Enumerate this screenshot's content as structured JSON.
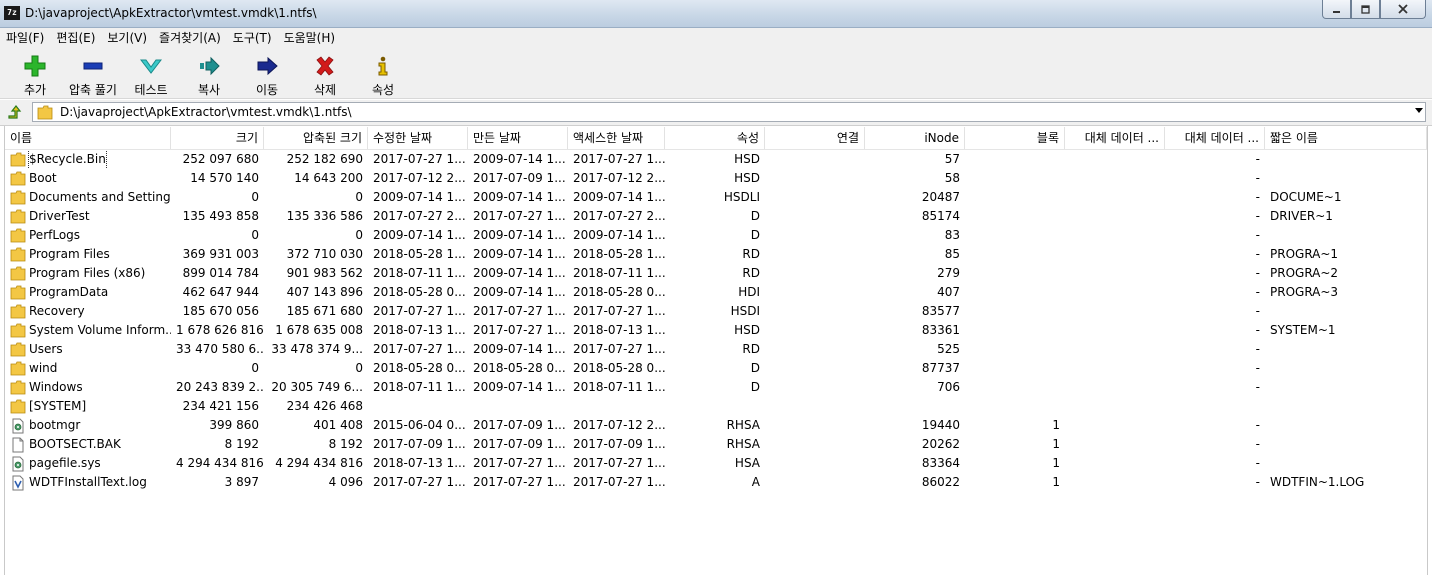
{
  "window": {
    "app_icon_text": "7z",
    "title": "D:\\javaproject\\ApkExtractor\\vmtest.vmdk\\1.ntfs\\",
    "controls": [
      "minimize",
      "maximize",
      "close"
    ]
  },
  "menu": [
    "파일(F)",
    "편집(E)",
    "보기(V)",
    "즐겨찾기(A)",
    "도구(T)",
    "도움말(H)"
  ],
  "toolbar": [
    {
      "label": "추가",
      "icon": "add-icon",
      "color": "#2bb52b"
    },
    {
      "label": "압축 풀기",
      "icon": "extract-icon",
      "color": "#1a3db5"
    },
    {
      "label": "테스트",
      "icon": "test-icon",
      "color": "#2fb5b5"
    },
    {
      "label": "복사",
      "icon": "copy-icon",
      "color": "#1e8f8f"
    },
    {
      "label": "이동",
      "icon": "move-icon",
      "color": "#1a2a8f"
    },
    {
      "label": "삭제",
      "icon": "delete-icon",
      "color": "#d21b1b"
    },
    {
      "label": "속성",
      "icon": "info-icon",
      "color": "#c9a400"
    }
  ],
  "address": {
    "path": "D:\\javaproject\\ApkExtractor\\vmtest.vmdk\\1.ntfs\\"
  },
  "columns": [
    "이름",
    "크기",
    "압축된 크기",
    "수정한 날짜",
    "만든 날짜",
    "액세스한 날짜",
    "속성",
    "연결",
    "iNode",
    "블록",
    "대체 데이터 ...",
    "대체 데이터 ...",
    "짧은 이름"
  ],
  "files": [
    {
      "name": "$Recycle.Bin",
      "type": "folder",
      "size": "252 097 680",
      "packed": "252 182 690",
      "modified": "2017-07-27 1...",
      "created": "2009-07-14 1...",
      "accessed": "2017-07-27 1...",
      "attr": "HSD",
      "link": "",
      "inode": "57",
      "blocks": "",
      "alt1": "",
      "alt2": "-",
      "short": ""
    },
    {
      "name": "Boot",
      "type": "folder",
      "size": "14 570 140",
      "packed": "14 643 200",
      "modified": "2017-07-12 2...",
      "created": "2017-07-09 1...",
      "accessed": "2017-07-12 2...",
      "attr": "HSD",
      "link": "",
      "inode": "58",
      "blocks": "",
      "alt1": "",
      "alt2": "-",
      "short": ""
    },
    {
      "name": "Documents and Settings",
      "type": "folder",
      "size": "0",
      "packed": "0",
      "modified": "2009-07-14 1...",
      "created": "2009-07-14 1...",
      "accessed": "2009-07-14 1...",
      "attr": "HSDLI",
      "link": "",
      "inode": "20487",
      "blocks": "",
      "alt1": "",
      "alt2": "-",
      "short": "DOCUME~1"
    },
    {
      "name": "DriverTest",
      "type": "folder",
      "size": "135 493 858",
      "packed": "135 336 586",
      "modified": "2017-07-27 2...",
      "created": "2017-07-27 1...",
      "accessed": "2017-07-27 2...",
      "attr": "D",
      "link": "",
      "inode": "85174",
      "blocks": "",
      "alt1": "",
      "alt2": "-",
      "short": "DRIVER~1"
    },
    {
      "name": "PerfLogs",
      "type": "folder",
      "size": "0",
      "packed": "0",
      "modified": "2009-07-14 1...",
      "created": "2009-07-14 1...",
      "accessed": "2009-07-14 1...",
      "attr": "D",
      "link": "",
      "inode": "83",
      "blocks": "",
      "alt1": "",
      "alt2": "-",
      "short": ""
    },
    {
      "name": "Program Files",
      "type": "folder",
      "size": "369 931 003",
      "packed": "372 710 030",
      "modified": "2018-05-28 1...",
      "created": "2009-07-14 1...",
      "accessed": "2018-05-28 1...",
      "attr": "RD",
      "link": "",
      "inode": "85",
      "blocks": "",
      "alt1": "",
      "alt2": "-",
      "short": "PROGRA~1"
    },
    {
      "name": "Program Files (x86)",
      "type": "folder",
      "size": "899 014 784",
      "packed": "901 983 562",
      "modified": "2018-07-11 1...",
      "created": "2009-07-14 1...",
      "accessed": "2018-07-11 1...",
      "attr": "RD",
      "link": "",
      "inode": "279",
      "blocks": "",
      "alt1": "",
      "alt2": "-",
      "short": "PROGRA~2"
    },
    {
      "name": "ProgramData",
      "type": "folder",
      "size": "462 647 944",
      "packed": "407 143 896",
      "modified": "2018-05-28 0...",
      "created": "2009-07-14 1...",
      "accessed": "2018-05-28 0...",
      "attr": "HDI",
      "link": "",
      "inode": "407",
      "blocks": "",
      "alt1": "",
      "alt2": "-",
      "short": "PROGRA~3"
    },
    {
      "name": "Recovery",
      "type": "folder",
      "size": "185 670 056",
      "packed": "185 671 680",
      "modified": "2017-07-27 1...",
      "created": "2017-07-27 1...",
      "accessed": "2017-07-27 1...",
      "attr": "HSDI",
      "link": "",
      "inode": "83577",
      "blocks": "",
      "alt1": "",
      "alt2": "-",
      "short": ""
    },
    {
      "name": "System Volume Inform...",
      "type": "folder",
      "size": "1 678 626 816",
      "packed": "1 678 635 008",
      "modified": "2018-07-13 1...",
      "created": "2017-07-27 1...",
      "accessed": "2018-07-13 1...",
      "attr": "HSD",
      "link": "",
      "inode": "83361",
      "blocks": "",
      "alt1": "",
      "alt2": "-",
      "short": "SYSTEM~1"
    },
    {
      "name": "Users",
      "type": "folder",
      "size": "33 470 580 6...",
      "packed": "33 478 374 9...",
      "modified": "2017-07-27 1...",
      "created": "2009-07-14 1...",
      "accessed": "2017-07-27 1...",
      "attr": "RD",
      "link": "",
      "inode": "525",
      "blocks": "",
      "alt1": "",
      "alt2": "-",
      "short": ""
    },
    {
      "name": "wind",
      "type": "folder",
      "size": "0",
      "packed": "0",
      "modified": "2018-05-28 0...",
      "created": "2018-05-28 0...",
      "accessed": "2018-05-28 0...",
      "attr": "D",
      "link": "",
      "inode": "87737",
      "blocks": "",
      "alt1": "",
      "alt2": "-",
      "short": ""
    },
    {
      "name": "Windows",
      "type": "folder",
      "size": "20 243 839 2...",
      "packed": "20 305 749 6...",
      "modified": "2018-07-11 1...",
      "created": "2009-07-14 1...",
      "accessed": "2018-07-11 1...",
      "attr": "D",
      "link": "",
      "inode": "706",
      "blocks": "",
      "alt1": "",
      "alt2": "-",
      "short": ""
    },
    {
      "name": "[SYSTEM]",
      "type": "folder",
      "size": "234 421 156",
      "packed": "234 426 468",
      "modified": "",
      "created": "",
      "accessed": "",
      "attr": "",
      "link": "",
      "inode": "",
      "blocks": "",
      "alt1": "",
      "alt2": "",
      "short": ""
    },
    {
      "name": "bootmgr",
      "type": "sysfile",
      "size": "399 860",
      "packed": "401 408",
      "modified": "2015-06-04 0...",
      "created": "2017-07-09 1...",
      "accessed": "2017-07-12 2...",
      "attr": "RHSA",
      "link": "",
      "inode": "19440",
      "blocks": "1",
      "alt1": "",
      "alt2": "-",
      "short": ""
    },
    {
      "name": "BOOTSECT.BAK",
      "type": "file",
      "size": "8 192",
      "packed": "8 192",
      "modified": "2017-07-09 1...",
      "created": "2017-07-09 1...",
      "accessed": "2017-07-09 1...",
      "attr": "RHSA",
      "link": "",
      "inode": "20262",
      "blocks": "1",
      "alt1": "",
      "alt2": "-",
      "short": ""
    },
    {
      "name": "pagefile.sys",
      "type": "sysfile",
      "size": "4 294 434 816",
      "packed": "4 294 434 816",
      "modified": "2018-07-13 1...",
      "created": "2017-07-27 1...",
      "accessed": "2017-07-27 1...",
      "attr": "HSA",
      "link": "",
      "inode": "83364",
      "blocks": "1",
      "alt1": "",
      "alt2": "-",
      "short": ""
    },
    {
      "name": "WDTFInstallText.log",
      "type": "logfile",
      "size": "3 897",
      "packed": "4 096",
      "modified": "2017-07-27 1...",
      "created": "2017-07-27 1...",
      "accessed": "2017-07-27 1...",
      "attr": "A",
      "link": "",
      "inode": "86022",
      "blocks": "1",
      "alt1": "",
      "alt2": "-",
      "short": "WDTFIN~1.LOG"
    }
  ]
}
